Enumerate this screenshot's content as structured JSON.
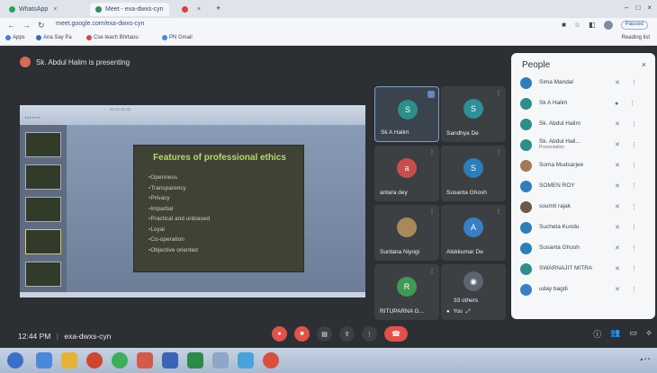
{
  "browser": {
    "tabs": [
      {
        "label": "WhatsApp",
        "color": "#25a35a"
      },
      {
        "label": "Meet - exa-dwxs-cyn",
        "color": "#2f8f5f"
      },
      {
        "label": "",
        "color": "#d94040"
      }
    ],
    "url": "meet.google.com/exa-dwxs-cyn",
    "bookmarks": [
      "Apps",
      "Ana Say Pa",
      "Cse teach Bhrtaou",
      "PN Gmail"
    ],
    "reading_list": "Reading list",
    "paused_label": "Paused"
  },
  "meet": {
    "presenting_text": "Sk. Abdul Halim is presenting",
    "slide": {
      "title": "Features of professional ethics",
      "bullets": [
        "Openness",
        "Transparency",
        "Privacy",
        "Impartial",
        "Practical and unbiased",
        "Loyal",
        "Co-operation",
        "Objective oriented"
      ]
    },
    "tiles": [
      {
        "name": "Sk A Halim",
        "initial": "S",
        "color": "#2e8f8a",
        "speaking": true
      },
      {
        "name": "Sandhya De",
        "initial": "S",
        "color": "#2e8f9a",
        "speaking": false
      },
      {
        "name": "antara dey",
        "initial": "a",
        "color": "#c84e4e",
        "speaking": false
      },
      {
        "name": "Susanta Ghosh",
        "initial": "S",
        "color": "#2a7fb8",
        "speaking": false
      },
      {
        "name": "Suntana Niyogi",
        "initial": "",
        "color": "#a88a5a",
        "speaking": false
      },
      {
        "name": "Alokkumar De",
        "initial": "A",
        "color": "#3a7fc4",
        "speaking": false
      },
      {
        "name": "RITUPARNA G...",
        "initial": "R",
        "color": "#3f9a55",
        "speaking": false
      },
      {
        "name": "33 others",
        "initial": "",
        "color": "#5b6470",
        "speaking": false
      }
    ],
    "you_label": "You",
    "clock": "12:44 PM",
    "meeting_code": "exa-dwxs-cyn"
  },
  "people": {
    "title": "People",
    "list": [
      {
        "name": "Sima Mandal",
        "sub": "",
        "color": "#2e7fb8"
      },
      {
        "name": "Sk A Halim",
        "sub": "",
        "color": "#2e8f8a"
      },
      {
        "name": "Sk. Abdul Halim",
        "sub": "",
        "color": "#2e8f8a"
      },
      {
        "name": "Sk. Abdul Hali...",
        "sub": "Presentation",
        "color": "#2e8f8a"
      },
      {
        "name": "Soma Mudsarjee",
        "sub": "",
        "color": "#a07b55"
      },
      {
        "name": "SOMEN ROY",
        "sub": "",
        "color": "#2e7fb8"
      },
      {
        "name": "soumit rajak",
        "sub": "",
        "color": "#6b5a4a"
      },
      {
        "name": "Sucheta Kundu",
        "sub": "",
        "color": "#2e7fb8"
      },
      {
        "name": "Susanta Ghosh",
        "sub": "",
        "color": "#2a7fb8"
      },
      {
        "name": "SWARNAJIT MITRA",
        "sub": "",
        "color": "#2e8f8a"
      },
      {
        "name": "uday bagdi",
        "sub": "",
        "color": "#3a7fc4"
      }
    ]
  }
}
